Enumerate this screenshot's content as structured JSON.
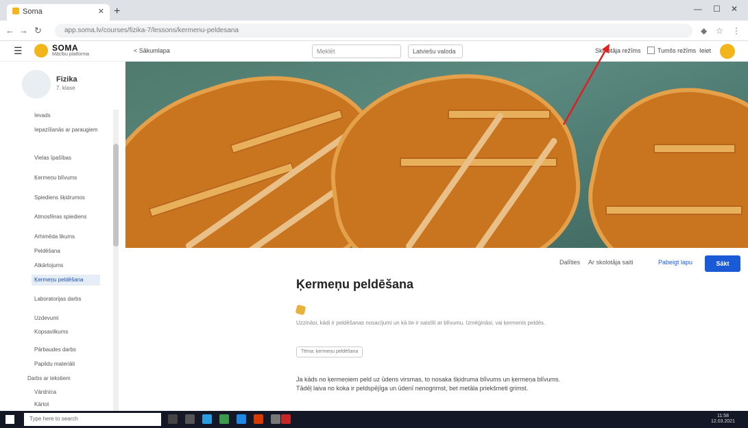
{
  "browser": {
    "tab_title": "Soma",
    "url": "app.soma.lv/courses/fizika-7/lessons/kermenu-peldesana"
  },
  "header": {
    "logo": "SOMA",
    "logo_sub": "Mācību platforma",
    "back_link": "< Sākumlapa",
    "search_placeholder": "Meklēt",
    "language": "Latviešu valoda",
    "link_1": "Skolotāja režīms",
    "link_2": "Tumšs režīms",
    "link_3": "Ieiet"
  },
  "sidebar": {
    "subject_title": "Fizika",
    "subject_sub": "7. klase",
    "items": [
      {
        "label": "Ievads"
      },
      {
        "label": "Iepazīšanās ar paraugiem"
      },
      {
        "label": "Vielas īpašības"
      },
      {
        "label": "Ķermeņu blīvums"
      },
      {
        "label": "Spiediens šķidrumos"
      },
      {
        "label": "Atmosfēras spiediens"
      },
      {
        "label": "Arhimēda likums"
      },
      {
        "label": "Peldēšana"
      },
      {
        "label": "Atkārtojums"
      },
      {
        "label": "Ķermeņu peldēšana"
      },
      {
        "label": "Laboratorijas darbs"
      },
      {
        "label": "Uzdevumi"
      },
      {
        "label": "Kopsavilkums"
      },
      {
        "label": "Pārbaudes darbs"
      },
      {
        "label": "Papildu materiāli"
      },
      {
        "label": "Darbs ar tekstiem"
      },
      {
        "label": "Vārdnīca"
      },
      {
        "label": "Kārtot"
      }
    ]
  },
  "toolbar": {
    "share": "Dalīties",
    "teacher_view": "Ar skolotāja saiti",
    "mark_done": "Pabeigt lapu",
    "start": "Sākt"
  },
  "lesson": {
    "title": "Ķermeņu peldēšana",
    "description": "Uzzināsi, kādi ir peldēšanas nosacījumi un kā tie ir saistīti ar blīvumu. Izmēģināsi, vai ķermenis peldēs.",
    "tag": "Tēma: ķermeņu peldēšana",
    "body": "Ja kāds no ķermeņiem peld uz ūdens virsmas, to nosaka šķidruma blīvums un ķermeņa blīvums. Tādēļ laiva no koka ir peldspējīga un ūdenī nenogrimst, bet metāla priekšmeti grimst."
  },
  "taskbar": {
    "search": "Type here to search",
    "time": "11:58",
    "date": "12.03.2021"
  },
  "colors": {
    "accent": "#1a5ad7",
    "brand": "#f2b51b",
    "annotation": "#e02020"
  }
}
